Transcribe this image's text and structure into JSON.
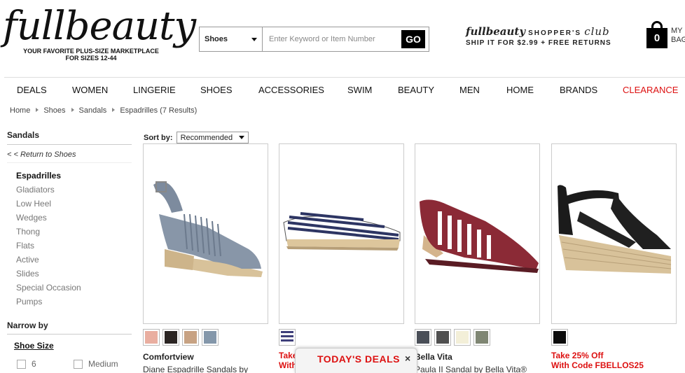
{
  "header": {
    "logo": "fullbeauty",
    "tagline_line1": "YOUR FAVORITE PLUS-SIZE MARKETPLACE",
    "tagline_line2": "FOR SIZES 12-44",
    "search": {
      "category": "Shoes",
      "placeholder": "Enter Keyword or Item Number",
      "button": "GO"
    },
    "club": {
      "brand": "fullbeauty",
      "label": "SHOPPER'S",
      "script": "club",
      "offer": "SHIP IT FOR $2.99 + FREE RETURNS"
    },
    "bag": {
      "count": "0",
      "label_line1": "MY",
      "label_line2": "BAG"
    }
  },
  "nav": {
    "items": [
      "DEALS",
      "WOMEN",
      "LINGERIE",
      "SHOES",
      "ACCESSORIES",
      "SWIM",
      "BEAUTY",
      "MEN",
      "HOME",
      "BRANDS",
      "CLEARANCE"
    ]
  },
  "breadcrumb": [
    "Home",
    "Shoes",
    "Sandals",
    "Espadrilles (7 Results)"
  ],
  "sidebar": {
    "title": "Sandals",
    "back_link": "< < Return to Shoes",
    "items": [
      "Espadrilles",
      "Gladiators",
      "Low Heel",
      "Wedges",
      "Thong",
      "Flats",
      "Active",
      "Slides",
      "Special Occasion",
      "Pumps"
    ],
    "narrow_title": "Narrow by",
    "filter_title": "Shoe Size",
    "size_options": [
      "6",
      "Medium"
    ]
  },
  "sort": {
    "label": "Sort by:",
    "value": "Recommended"
  },
  "products": [
    {
      "brand": "Comfortview",
      "name": "Diane Espadrille Sandals by",
      "promo1": "",
      "promo2": "",
      "swatches": [
        "#e9aea0",
        "#2b2523",
        "#c7a283",
        "#8497aa"
      ]
    },
    {
      "brand": "",
      "name": "",
      "promo1": "Take",
      "promo2": "With",
      "swatches": [
        "#3e3f7a"
      ]
    },
    {
      "brand": "Bella Vita",
      "name": "Paula II Sandal by Bella Vita®",
      "promo1": "",
      "promo2": "",
      "swatches": [
        "#4a4f58",
        "#505050",
        "#f3efd8",
        "#7f8673"
      ]
    },
    {
      "brand": "",
      "name": "",
      "promo1": "Take 25% Off",
      "promo2": "With Code FBELLOS25",
      "swatches": [
        "#0c0c0c"
      ]
    }
  ],
  "deals_tab": {
    "label": "TODAY'S DEALS",
    "close": "×"
  },
  "colors": {
    "accent_red": "#dd1111",
    "text": "#222222"
  }
}
